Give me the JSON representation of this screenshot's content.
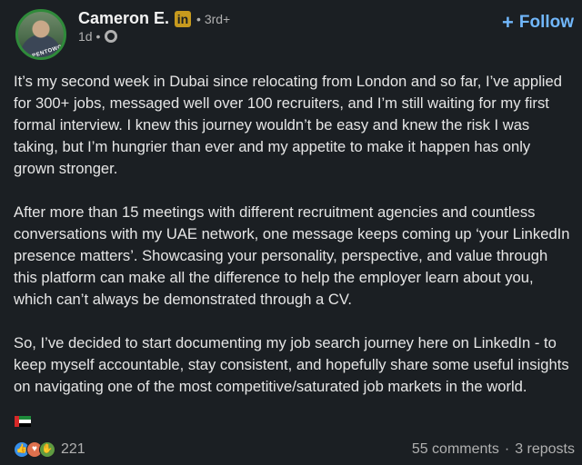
{
  "author": {
    "name": "Cameron E.",
    "badge": "in",
    "degree": "• 3rd+",
    "timestamp": "1d •",
    "avatar_ring_text": "#OPENTOWORK"
  },
  "follow": {
    "plus": "+",
    "label": "Follow"
  },
  "post": {
    "paragraphs": [
      "It’s my second week in Dubai since relocating from London and so far, I’ve applied for 300+ jobs, messaged well over 100 recruiters, and I’m still waiting for my first formal interview. I knew this journey wouldn’t be easy and knew the risk I was taking, but I’m hungrier than ever and my appetite to make it happen has only grown stronger.",
      "After more than 15 meetings with different recruitment agencies and countless conversations with my UAE network, one message keeps coming up ‘your LinkedIn presence matters’. Showcasing your personality, perspective, and value through this platform can make all the difference to help the employer learn about you, which can’t always be demonstrated through a CV.",
      "So, I’ve decided to start documenting my job search journey here on LinkedIn - to keep myself accountable, stay consistent, and hopefully share some useful insights on navigating one of the most competitive/saturated job markets in the world."
    ]
  },
  "reactions": {
    "count": "221",
    "icons": [
      "like-icon",
      "love-icon",
      "support-icon"
    ]
  },
  "stats": {
    "comments": "55 comments",
    "separator": "·",
    "reposts": "3 reposts"
  },
  "colors": {
    "background": "#1b1f23",
    "accent": "#71b7fb",
    "badge": "#c79a1e"
  }
}
